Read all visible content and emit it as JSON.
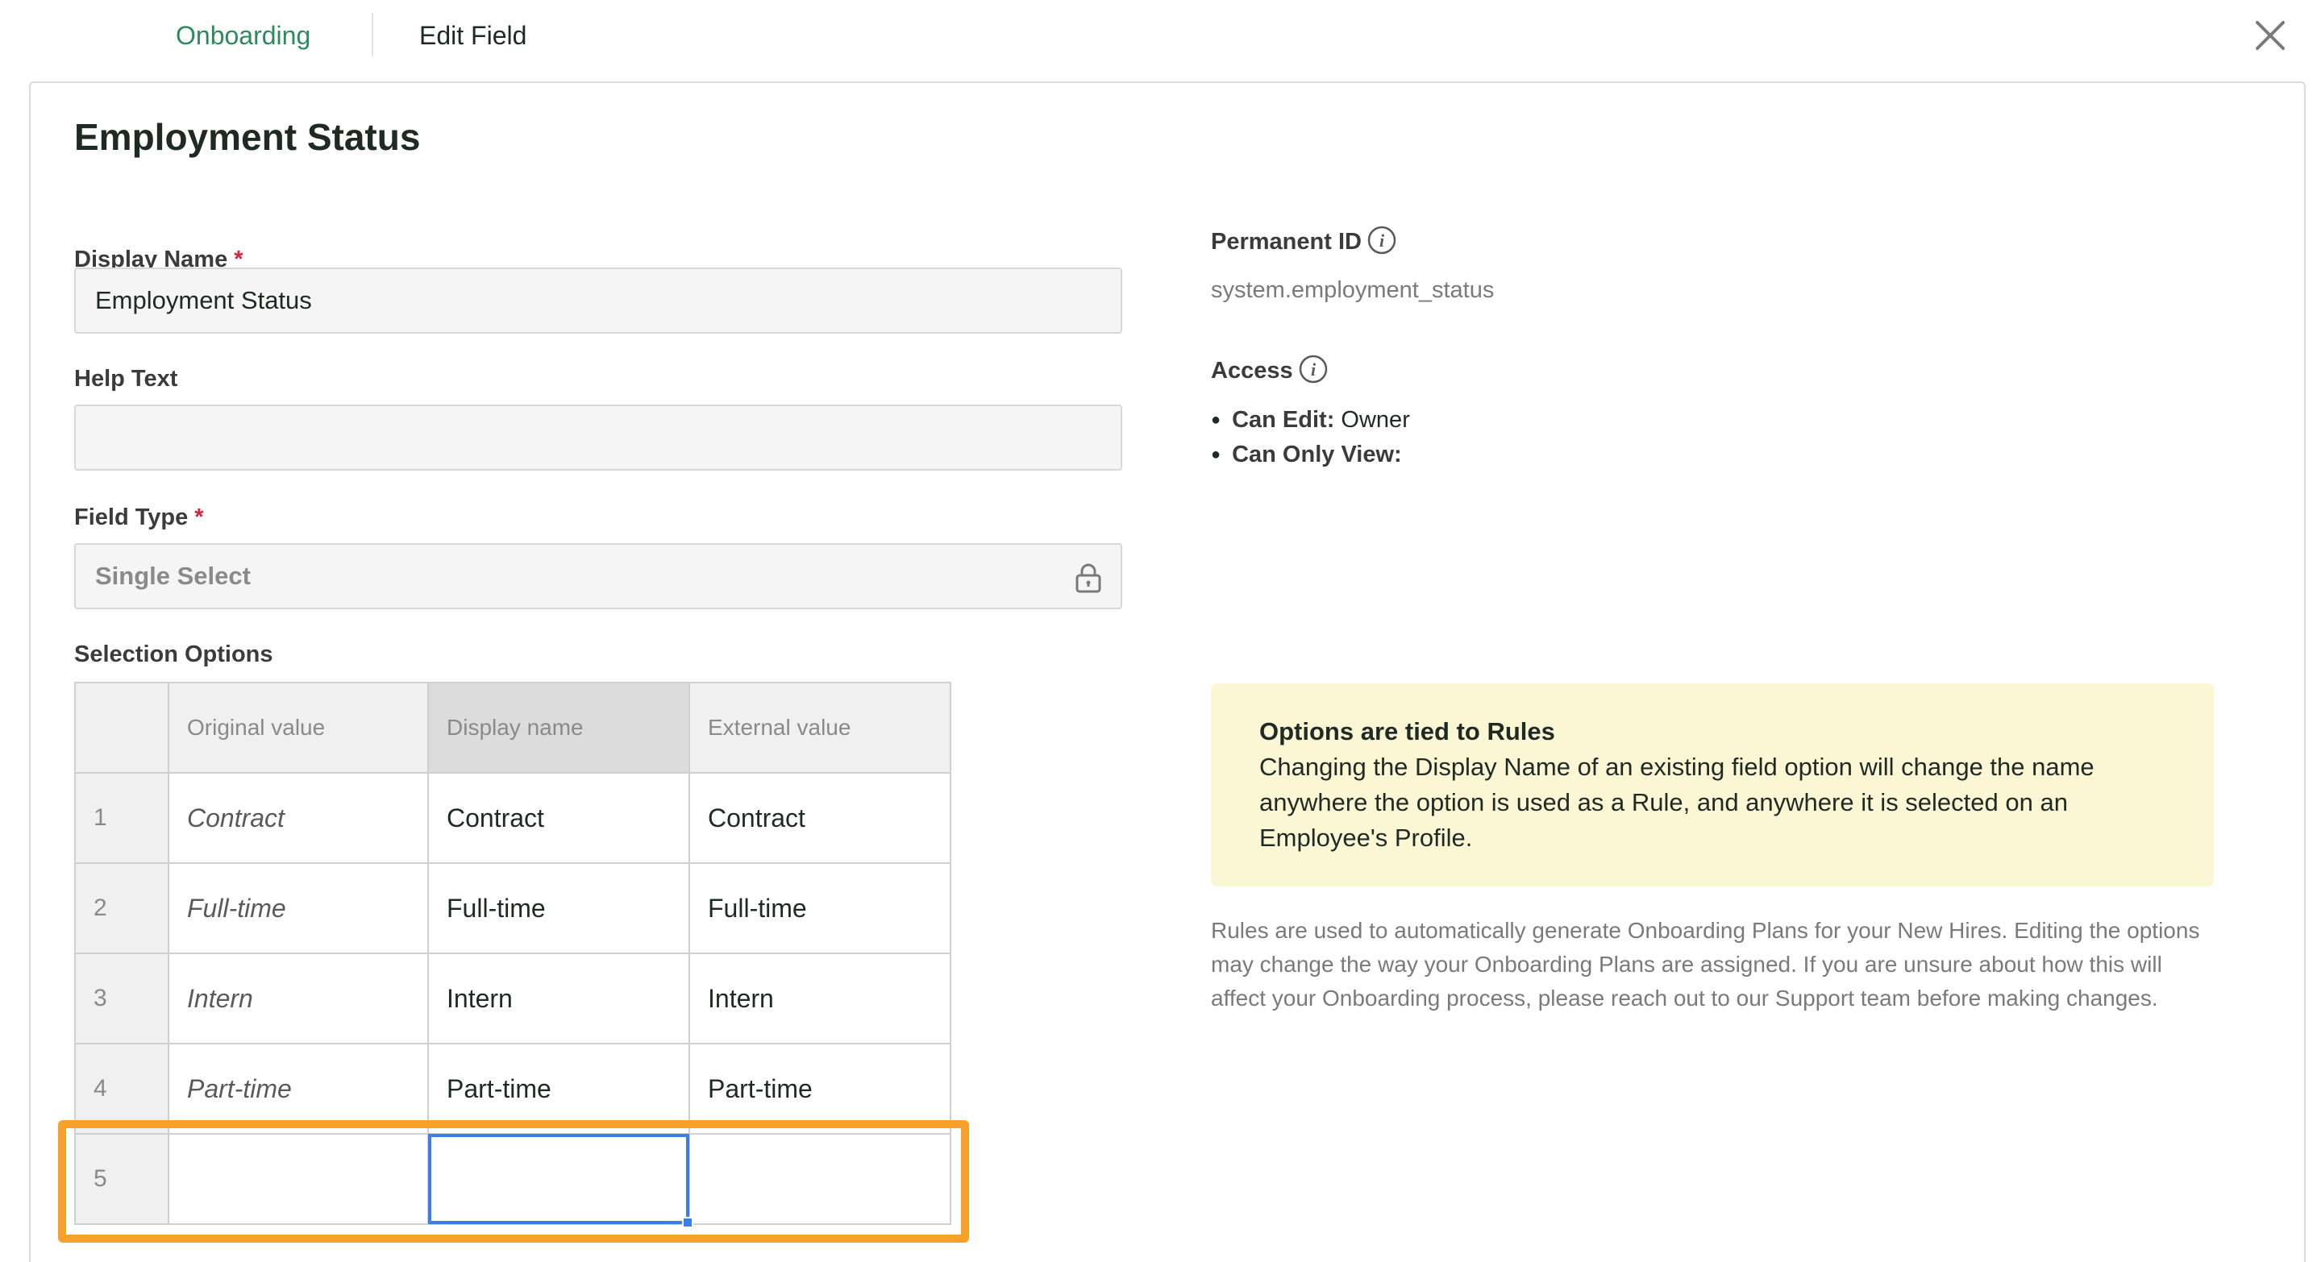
{
  "breadcrumb": {
    "root": "Onboarding",
    "current": "Edit Field"
  },
  "page_title": "Employment Status",
  "form": {
    "display_name_label": "Display Name",
    "display_name_value": "Employment Status",
    "help_text_label": "Help Text",
    "help_text_value": "",
    "field_type_label": "Field Type",
    "field_type_value": "Single Select",
    "required_mark": "*",
    "selection_options_label": "Selection Options"
  },
  "table": {
    "headers": [
      "Original value",
      "Display name",
      "External value"
    ],
    "rows": [
      {
        "num": "1",
        "original": "Contract",
        "display": "Contract",
        "external": "Contract"
      },
      {
        "num": "2",
        "original": "Full-time",
        "display": "Full-time",
        "external": "Full-time"
      },
      {
        "num": "3",
        "original": "Intern",
        "display": "Intern",
        "external": "Intern"
      },
      {
        "num": "4",
        "original": "Part-time",
        "display": "Part-time",
        "external": "Part-time"
      },
      {
        "num": "5",
        "original": "",
        "display": "",
        "external": ""
      }
    ]
  },
  "side": {
    "permanent_id_label": "Permanent ID",
    "permanent_id_value": "system.employment_status",
    "access_label": "Access",
    "access_items": [
      {
        "key": "Can Edit:",
        "value": " Owner"
      },
      {
        "key": "Can Only View:",
        "value": ""
      }
    ]
  },
  "notice": {
    "title": "Options are tied to Rules",
    "body": "Changing the Display Name of an existing field option will change the name anywhere the option is used as a Rule, and anywhere it is selected on an Employee's Profile."
  },
  "rules_text": "Rules are used to automatically generate Onboarding Plans for your New Hires. Editing the options may change the way your Onboarding Plans are assigned. If you are unsure about how this will affect your Onboarding process, please reach out to our Support team before making changes.",
  "colors": {
    "accent": "#2d8a5e",
    "highlight": "#f7a12a",
    "selection": "#3b7de9",
    "notice_bg": "#fbf7d5",
    "required": "#d0243a"
  },
  "icons": {
    "close": "close-icon",
    "lock": "lock-icon",
    "info": "info-icon"
  }
}
